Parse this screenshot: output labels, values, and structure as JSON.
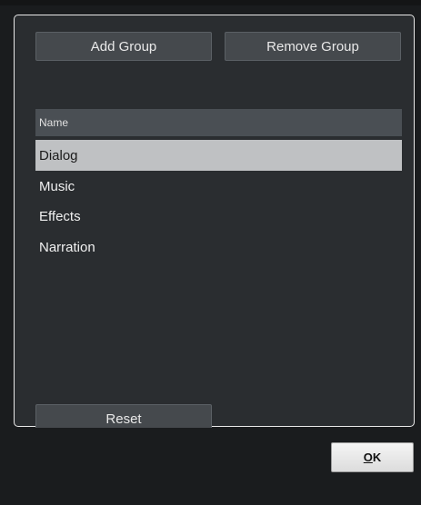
{
  "toolbar": {
    "add_group_label": "Add Group",
    "remove_group_label": "Remove Group"
  },
  "group_list": {
    "column_header": "Name",
    "rows": [
      {
        "name": "Dialog",
        "selected": true
      },
      {
        "name": "Music",
        "selected": false
      },
      {
        "name": "Effects",
        "selected": false
      },
      {
        "name": "Narration",
        "selected": false
      }
    ]
  },
  "footer": {
    "reset_label": "Reset",
    "ok_mnemonic": "O",
    "ok_rest": "K"
  }
}
